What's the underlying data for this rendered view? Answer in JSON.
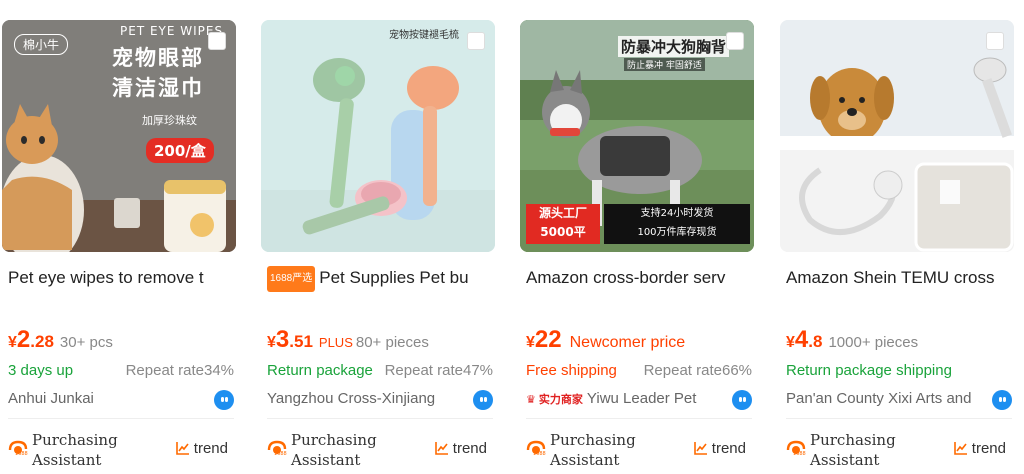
{
  "products": [
    {
      "image": {
        "big": "宠物眼部",
        "big2": "清洁湿巾",
        "brand": "棉小牛",
        "en": "PET EYE WIPES",
        "sub": "加厚珍珠纹",
        "badge": "200/盒"
      },
      "title": "Pet eye wipes to remove t",
      "price_currency": "¥",
      "price_int": "2",
      "price_dec": ".28",
      "quantity": "30+ pcs",
      "plus": "",
      "promo": "",
      "feature": "3 days up",
      "feature_color": "green",
      "repeat": "Repeat rate34%",
      "seller": "Anhui Junkai",
      "strong_tag": "",
      "assistant_label": "Purchasing Assistant",
      "trend_label": "trend"
    },
    {
      "image": {
        "big": "宠物按键褪毛梳"
      },
      "badge_1688": "1688严选",
      "title": "Pet Supplies Pet bu",
      "price_currency": "¥",
      "price_int": "3",
      "price_dec": ".51",
      "quantity": "80+ pieces",
      "plus": "PLUS",
      "promo": "",
      "feature": "Return package",
      "feature_color": "green",
      "repeat": "Repeat rate47%",
      "seller": "Yangzhou Cross-Xinjiang",
      "strong_tag": "",
      "assistant_label": "Purchasing Assistant",
      "trend_label": "trend"
    },
    {
      "image": {
        "big": "防暴冲大狗胸背",
        "sub": "防止暴冲 牢固舒适",
        "badge": "源头工厂",
        "badge2": "5000平",
        "note": "支持24小时发货",
        "note2": "100万件库存现货"
      },
      "title": "Amazon cross-border serv",
      "price_currency": "¥",
      "price_int": "22",
      "price_dec": "",
      "quantity": "",
      "plus": "",
      "promo": "Newcomer price",
      "feature": "Free shipping",
      "feature_color": "red",
      "repeat": "Repeat rate66%",
      "seller": "Yiwu Leader Pet",
      "strong_tag": "实力商家",
      "assistant_label": "Purchasing Assistant",
      "trend_label": "trend"
    },
    {
      "image": {},
      "title": "Amazon Shein TEMU cross",
      "price_currency": "¥",
      "price_int": "4",
      "price_dec": ".8",
      "quantity": "1000+ pieces",
      "plus": "",
      "promo": "",
      "feature": "Return package shipping",
      "feature_color": "green",
      "repeat": "",
      "seller": "Pan'an County Xixi Arts and",
      "strong_tag": "",
      "assistant_label": "Purchasing Assistant",
      "trend_label": "trend"
    }
  ],
  "colors": {
    "price": "#ff4000",
    "green": "#1aa33b",
    "bot": "#1e8ff0"
  },
  "icons": [
    "purchasing-assistant-icon",
    "trend-icon",
    "chat-bot-icon",
    "select-checkbox-icon"
  ]
}
